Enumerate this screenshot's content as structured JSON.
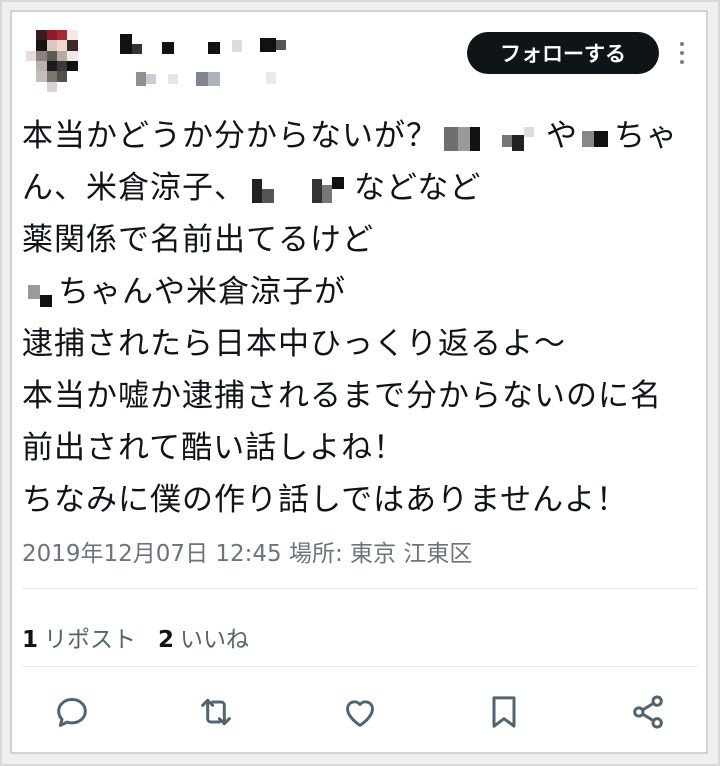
{
  "tweet": {
    "follow_label": "フォローする",
    "lines": [
      {
        "segments": [
          "本当かどうか分からないが？",
          "",
          "",
          "や",
          "ちゃ"
        ]
      },
      {
        "segments": [
          "ん、米倉涼子、",
          "",
          "などなど"
        ]
      },
      {
        "segments": [
          "薬関係で名前出てるけど"
        ]
      },
      {
        "segments": [
          "",
          "ちゃんや米倉涼子が"
        ]
      },
      {
        "segments": [
          "逮捕されたら日本中ひっくり返るよ～"
        ]
      },
      {
        "segments": [
          "本当か嘘か逮捕されるまで分からないのに名"
        ]
      },
      {
        "segments": [
          "前出されて酷い話しよね！"
        ]
      },
      {
        "segments": [
          "ちなみに僕の作り話しではありませんよ！"
        ]
      }
    ],
    "meta": "2019年12月07日 12:45 場所: 東京 江東区",
    "stats": {
      "reposts_count": "1",
      "reposts_label": "リポスト",
      "likes_count": "2",
      "likes_label": "いいね"
    }
  },
  "icons": {
    "reply": "reply-icon",
    "repost": "repost-icon",
    "like": "heart-icon",
    "bookmark": "bookmark-icon",
    "share": "share-icon",
    "more": "more-icon"
  },
  "colors": {
    "text": "#0f1419",
    "muted": "#6b737b",
    "button_bg": "#0f1419",
    "icon": "#536471"
  }
}
